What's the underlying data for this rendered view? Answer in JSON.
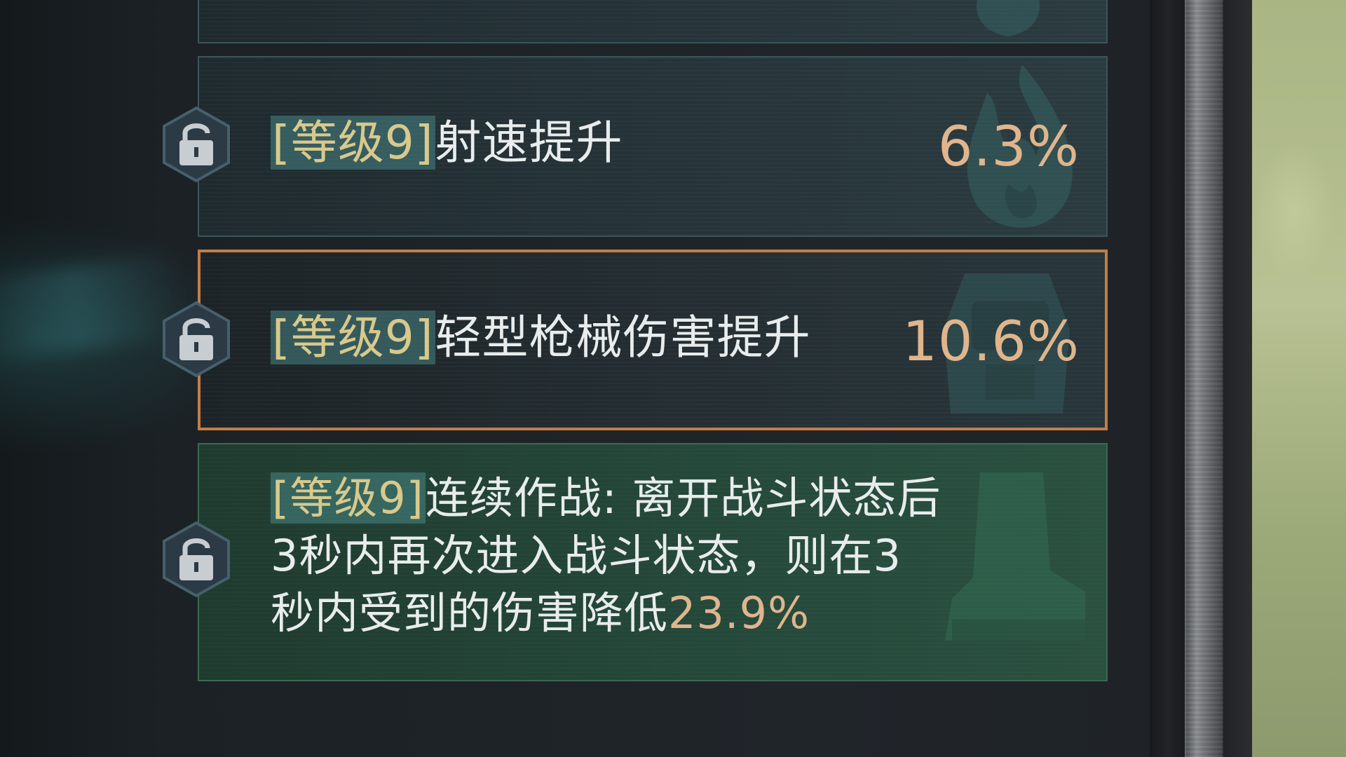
{
  "colors": {
    "tag_text": "#d8c98c",
    "tag_highlight": "#4f9696",
    "value_text": "#e0b58d",
    "body_text": "#e8ecec",
    "selected_border": "#c37d47",
    "green_panel": "#24483a"
  },
  "perks": [
    {
      "icon": "lock-icon",
      "tag": "[等级9]",
      "name": "射速提升",
      "value": "6.3%",
      "selected": false
    },
    {
      "icon": "lock-icon",
      "tag": "[等级9]",
      "name": "轻型枪械伤害提升",
      "value": "10.6%",
      "selected": true
    },
    {
      "icon": "lock-icon",
      "tag": "[等级9]",
      "line1": "连续作战: 离开战斗状态后",
      "line2": "3秒内再次进入战斗状态，则在3",
      "line3": "秒内受到的伤害降低",
      "value": "23.9%",
      "selected": false
    }
  ]
}
